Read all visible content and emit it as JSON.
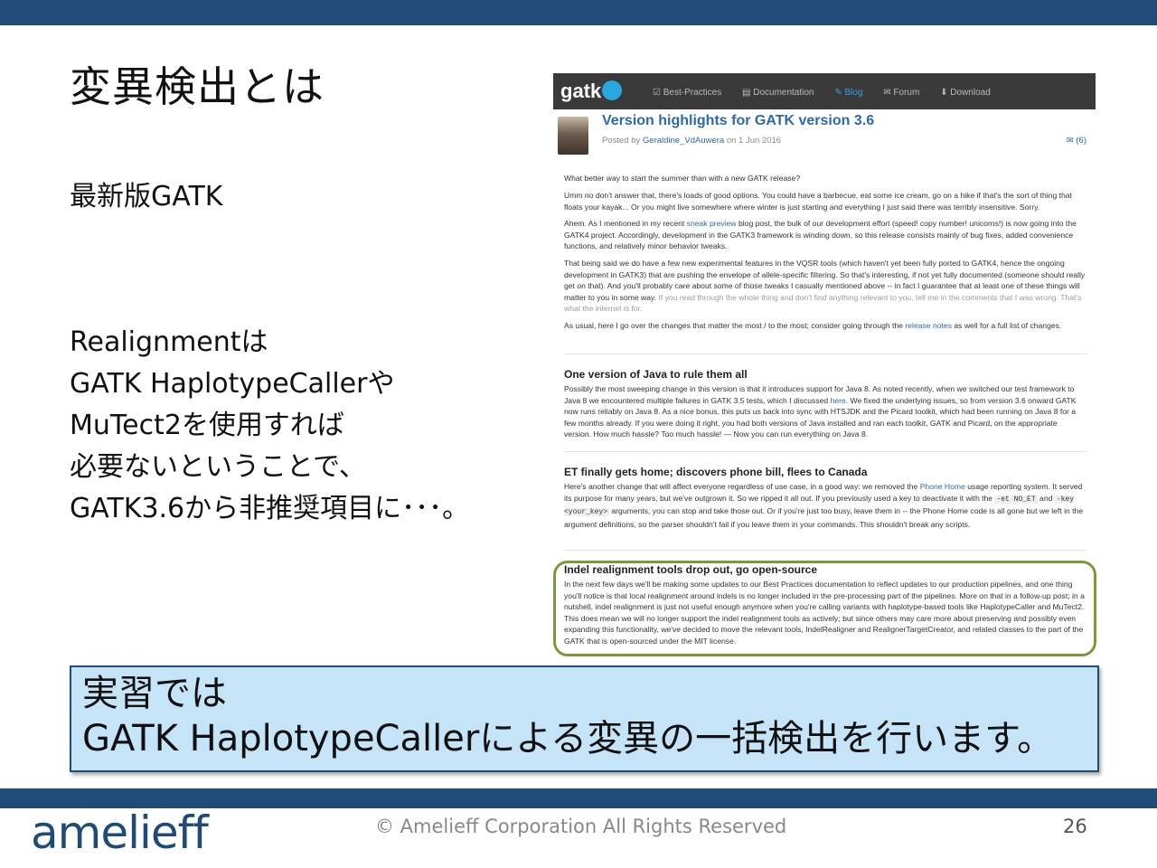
{
  "slide": {
    "title": "変異検出とは",
    "subtitle": "最新版GATK",
    "body_lines": [
      "Realignmentは",
      "GATK HaplotypeCallerや",
      "MuTect2を使用すれば",
      "必要ないということで、",
      "GATK3.6から非推奨項目に･･･。"
    ],
    "callout_line1": "実習では",
    "callout_line2": "GATK HaplotypeCallerによる変異の一括検出を行います。",
    "logo_text": "amelieff",
    "copyright": "© Amelieff Corporation All Rights Reserved",
    "page_number": "26"
  },
  "screenshot": {
    "logo": "gatk",
    "nav": [
      "Best-Practices",
      "Documentation",
      "Blog",
      "Forum",
      "Download"
    ],
    "post_title": "Version highlights for GATK version 3.6",
    "meta_prefix": "Posted by ",
    "author": "Geraldine_VdAuwera",
    "meta_suffix": " on 1 Jun 2016",
    "comments": "(6)",
    "p1": "What better way to start the summer than with a new GATK release?",
    "p2": "Umm no don't answer that, there's loads of good options. You could have a barbecue, eat some ice cream, go on a hike if that's the sort of thing that floats your kayak... Or you might live somewhere where winter is just starting and everything I just said there was terribly insensitive. Sorry.",
    "p3a": "Ahem. As I mentioned in my recent ",
    "p3link": "sneak preview",
    "p3b": " blog post, the bulk of our development effort (speed! copy number! unicorns!) is now going into the GATK4 project. Accordingly, development in the GATK3 framework is winding down, so this release consists mainly of bug fixes, added convenience functions, and relatively minor behavior tweaks.",
    "p4a": "That being said we do have a few new experimental features in the VQSR tools (which haven't yet been fully ported to GATK4, hence the ongoing development in GATK3) that are pushing the envelope of allele-specific filtering. So that's interesting, if not yet fully documented (someone should really get on that). And you'll probably care about some of those tweaks I casually mentioned above -- in fact I guarantee that at least one of these things will matter to you in some way.",
    "p4muted": " If you read through the whole thing and don't find anything relevant to you, tell me in the comments that I was wrong. That's what the internet is for.",
    "p5a": "As usual, here I go over the changes that matter the most / to the most; consider going through the ",
    "p5link": "release notes",
    "p5b": " as well for a full list of changes.",
    "h1": "One version of Java to rule them all",
    "s1a": "Possibly the most sweeping change in this version is that it introduces support for Java 8. As noted recently, when we switched our test framework to Java 8 we encountered multiple failures in GATK 3.5 tests, which I discussed ",
    "s1link": "here",
    "s1b": ". We fixed the underlying issues, so from version 3.6 onward GATK now runs reliably on Java 8. As a nice bonus, this puts us back into sync with HTSJDK and the Picard toolkit, which had been running on Java 8 for a few months already. If you were doing it right, you had both versions of Java installed and ran each toolkit, GATK and Picard, on the appropriate version. How much hassle? Too much hassle! — Now you can run everything on Java 8.",
    "h2": "ET finally gets home; discovers phone bill, flees to Canada",
    "s2a": "Here's another change that will affect everyone regardless of use case, in a good way: we removed the ",
    "s2link": "Phone Home",
    "s2b": " usage reporting system. It served its purpose for many years, but we've outgrown it. So we ripped it all out. If you previously used a key to deactivate it with the ",
    "s2code1": "-et NO_ET",
    "s2c": " and ",
    "s2code2": "-key <your_key>",
    "s2d": " arguments, you can stop and take those out. Or if you're just too busy, leave them in -- the Phone Home code is all gone but we left in the argument definitions, so the parser shouldn't fail if you leave them in your commands. This shouldn't break any scripts.",
    "h3": "Indel realignment tools drop out, go open-source",
    "s3": "In the next few days we'll be making some updates to our Best Practices documentation to reflect updates to our production pipelines, and one thing you'll notice is that local realignment around indels is no longer included in the pre-processing part of the pipelines. More on that in a follow-up post; in a nutshell, indel realignment is just not useful enough anymore when you're calling variants with haplotype-based tools like HaplotypeCaller and MuTect2. This does mean we will no longer support the indel realignment tools as actively; but since others may care more about preserving and possibly even expanding this functionality, we've decided to move the relevant tools, IndelRealigner and RealignerTargetCreator, and related classes to the part of the GATK that is open-sourced under the MIT license."
  },
  "colors": {
    "brand_bar": "#1f4b78",
    "callout_bg": "#c6e4f7",
    "highlight_box": "#7a9a3a",
    "link": "#2a6aad"
  }
}
